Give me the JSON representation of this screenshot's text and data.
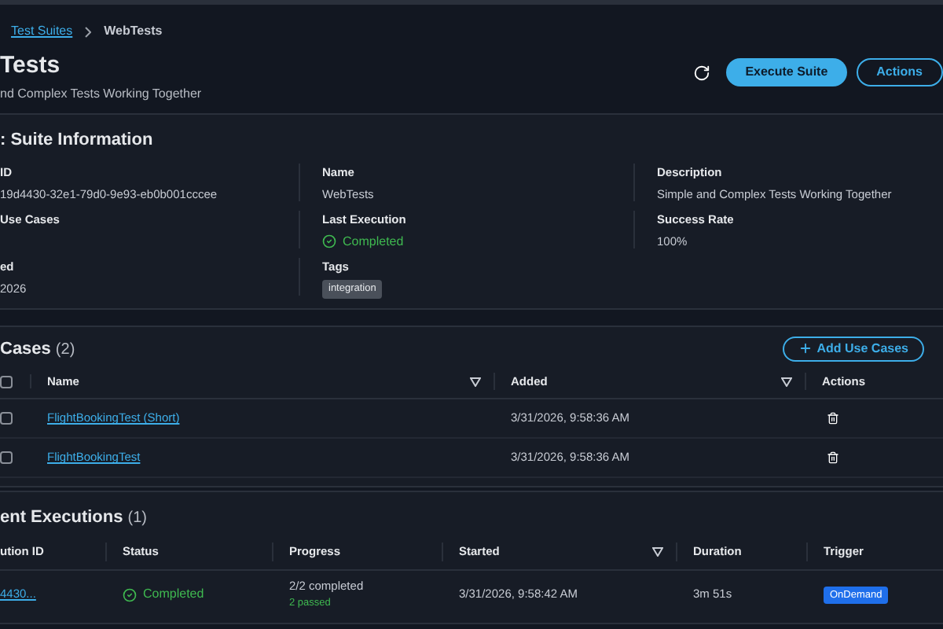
{
  "breadcrumb": [
    {
      "label": "Test Suites",
      "link": true
    },
    {
      "label": "WebTests",
      "link": false
    }
  ],
  "header": {
    "title": "Tests",
    "subtitle": "nd Complex Tests Working Together",
    "buttons": [
      {
        "label": "Execute Suite",
        "kind": "primary"
      },
      {
        "label": "Actions",
        "kind": "outline"
      }
    ]
  },
  "info": {
    "title": ": Suite Information",
    "fields": [
      {
        "label": "ID",
        "value": "19d4430-32e1-79d0-9e93-eb0b001cccee",
        "kind": "text"
      },
      {
        "label": "Name",
        "value": "WebTests",
        "kind": "text"
      },
      {
        "label": "Description",
        "value": "Simple and Complex Tests Working Together",
        "kind": "text"
      },
      {
        "label": "Use Cases",
        "kind": "empty"
      },
      {
        "label": "Last Execution",
        "value": "Completed",
        "kind": "status"
      },
      {
        "label": "Success Rate",
        "value": "100%",
        "kind": "text"
      },
      {
        "label": "ed",
        "value": "2026",
        "kind": "text"
      },
      {
        "label": "Tags",
        "value": "integration",
        "kind": "tag"
      }
    ]
  },
  "use_cases": {
    "title": "Cases",
    "count": "(2)",
    "add_button": "Add Use Cases",
    "header_checked": false,
    "columns": [
      {
        "label": "Name",
        "sortable": true
      },
      {
        "label": "Added",
        "sortable": true
      },
      {
        "label": "Actions",
        "sortable": false
      }
    ],
    "rows": [
      {
        "name": "FlightBookingTest (Short)",
        "added": "3/31/2026, 9:58:36 AM",
        "checked": false
      },
      {
        "name": "FlightBookingTest",
        "added": "3/31/2026, 9:58:36 AM",
        "checked": false
      }
    ]
  },
  "executions": {
    "title": "ent Executions",
    "count": "(1)",
    "columns": [
      {
        "label": "ution ID",
        "sortable": false
      },
      {
        "label": "Status",
        "sortable": false
      },
      {
        "label": "Progress",
        "sortable": false
      },
      {
        "label": "Started",
        "sortable": true
      },
      {
        "label": "Duration",
        "sortable": false
      },
      {
        "label": "Trigger",
        "sortable": false
      }
    ],
    "rows": [
      {
        "id": "4430...",
        "status": "Completed",
        "progress": "2/2 completed",
        "passed": "2 passed",
        "started": "3/31/2026, 9:58:42 AM",
        "duration": "3m 51s",
        "trigger": "OnDemand"
      }
    ]
  }
}
